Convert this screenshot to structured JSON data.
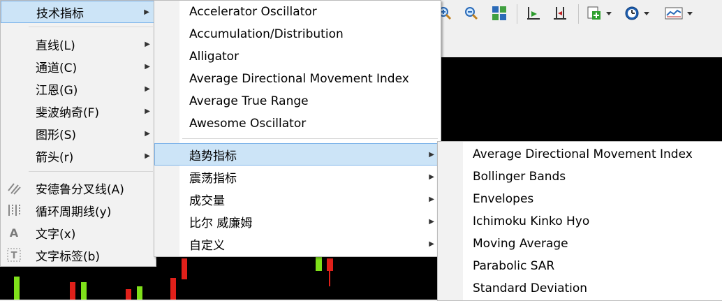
{
  "toolbar": {
    "buttons": [
      {
        "icon": "zoom-in-icon"
      },
      {
        "icon": "zoom-out-icon"
      },
      {
        "icon": "tile-windows-icon"
      },
      {
        "icon": "chart-shift-icon"
      },
      {
        "icon": "autoscroll-icon"
      },
      {
        "icon": "add-indicator-icon"
      },
      {
        "icon": "periods-clock-icon"
      },
      {
        "icon": "templates-icon"
      }
    ]
  },
  "menu_main": {
    "header": "技术指标",
    "items": [
      {
        "label": "直线(L)",
        "submenu": true
      },
      {
        "label": "通道(C)",
        "submenu": true
      },
      {
        "label": "江恩(G)",
        "submenu": true
      },
      {
        "label": "斐波纳奇(F)",
        "submenu": true
      },
      {
        "label": "图形(S)",
        "submenu": true
      },
      {
        "label": "箭头(r)",
        "submenu": true
      }
    ],
    "tools": [
      {
        "label": "安德鲁分叉线(A)",
        "icon": "andrews-pitchfork-icon"
      },
      {
        "label": "循环周期线(y)",
        "icon": "cycle-lines-icon"
      },
      {
        "label": "文字(x)",
        "icon": "text-icon"
      },
      {
        "label": "文字标签(b)",
        "icon": "text-label-icon"
      }
    ]
  },
  "menu_indicators": {
    "items": [
      "Accelerator Oscillator",
      "Accumulation/Distribution",
      "Alligator",
      "Average Directional Movement Index",
      "Average True Range",
      "Awesome Oscillator"
    ],
    "groups": [
      {
        "label": "趋势指标",
        "highlighted": true
      },
      {
        "label": "震荡指标"
      },
      {
        "label": "成交量"
      },
      {
        "label": "比尔 威廉姆"
      },
      {
        "label": "自定义"
      }
    ]
  },
  "menu_trend": {
    "items": [
      "Average Directional Movement Index",
      "Bollinger Bands",
      "Envelopes",
      "Ichimoku Kinko Hyo",
      "Moving Average",
      "Parabolic SAR",
      "Standard Deviation"
    ]
  },
  "colors": {
    "highlight": "#cce4f7",
    "highlight_border": "#7eb4ea",
    "chart_bg": "#000000",
    "bull_candle": "#7fe01a",
    "bear_candle": "#e0201a"
  }
}
